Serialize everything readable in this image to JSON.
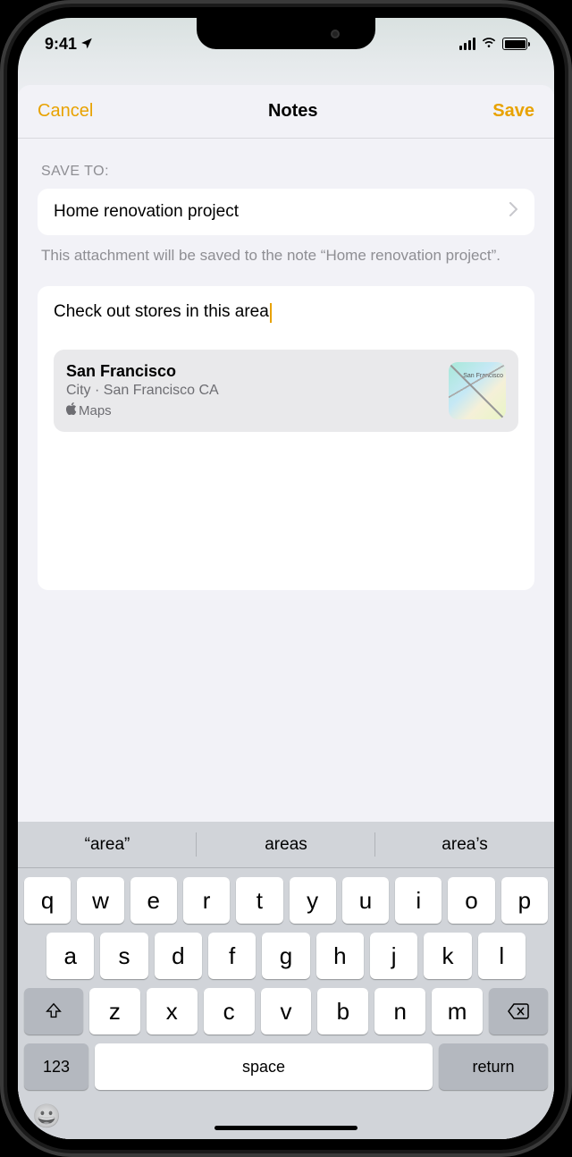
{
  "status": {
    "time": "9:41"
  },
  "nav": {
    "cancel": "Cancel",
    "title": "Notes",
    "save": "Save"
  },
  "section": {
    "label": "SAVE TO:",
    "destination": "Home renovation project",
    "helper": "This attachment will be saved to the note “Home renovation project”."
  },
  "note": {
    "text": "Check out stores in this area"
  },
  "attachment": {
    "title": "San Francisco",
    "subtitle": "City · San Francisco CA",
    "app": "Maps"
  },
  "keyboard": {
    "suggestions": [
      "“area”",
      "areas",
      "area’s"
    ],
    "row1": [
      "q",
      "w",
      "e",
      "r",
      "t",
      "y",
      "u",
      "i",
      "o",
      "p"
    ],
    "row2": [
      "a",
      "s",
      "d",
      "f",
      "g",
      "h",
      "j",
      "k",
      "l"
    ],
    "row3": [
      "z",
      "x",
      "c",
      "v",
      "b",
      "n",
      "m"
    ],
    "numkey": "123",
    "space": "space",
    "return": "return"
  }
}
